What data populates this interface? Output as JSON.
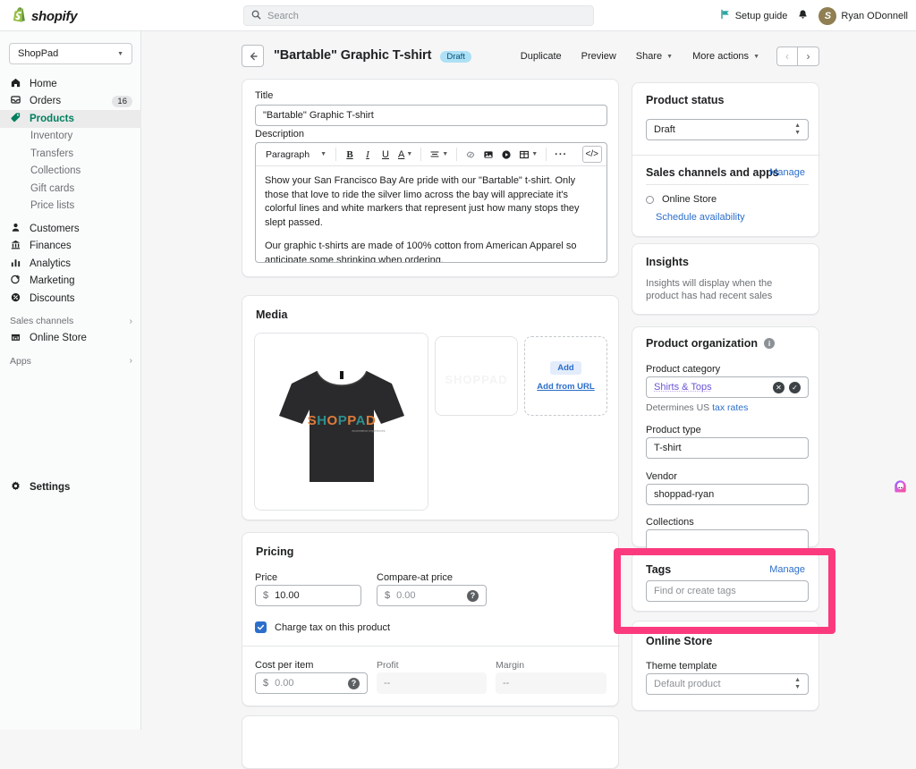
{
  "topbar": {
    "logo_text": "shopify",
    "search_placeholder": "Search",
    "setup_guide": "Setup guide",
    "user_name": "Ryan ODonnell",
    "avatar_letter": "S"
  },
  "sidebar": {
    "store": "ShopPad",
    "nav": [
      {
        "label": "Home"
      },
      {
        "label": "Orders",
        "badge": "16"
      },
      {
        "label": "Products"
      },
      {
        "label": "Customers"
      },
      {
        "label": "Finances"
      },
      {
        "label": "Analytics"
      },
      {
        "label": "Marketing"
      },
      {
        "label": "Discounts"
      }
    ],
    "product_subnav": [
      {
        "label": "Inventory"
      },
      {
        "label": "Transfers"
      },
      {
        "label": "Collections"
      },
      {
        "label": "Gift cards"
      },
      {
        "label": "Price lists"
      }
    ],
    "sales_channels_label": "Sales channels",
    "online_store": "Online Store",
    "apps_label": "Apps",
    "settings": "Settings"
  },
  "page_header": {
    "title": "\"Bartable\" Graphic T-shirt",
    "status_badge": "Draft",
    "duplicate": "Duplicate",
    "preview": "Preview",
    "share": "Share",
    "more_actions": "More actions"
  },
  "product": {
    "title_label": "Title",
    "title_value": "\"Bartable\" Graphic T-shirt",
    "description_label": "Description",
    "editor": {
      "block_style": "Paragraph",
      "paragraph_1": "Show your San Francisco Bay Are pride with our \"Bartable\" t-shirt. Only those that love to ride the silver limo across the bay will appreciate it's colorful lines and white markers that represent just how many stops they slept passed.",
      "paragraph_2": "Our graphic t-shirts are made of 100% cotton from American Apparel so anticipate some shrinking when ordering."
    },
    "media": {
      "title": "Media",
      "add_button": "Add",
      "add_from_url": "Add from URL",
      "shirt_logo": "SHOPPAD",
      "shirt_logo_sub": "ecommerce experiences"
    },
    "pricing": {
      "title": "Pricing",
      "price_label": "Price",
      "currency": "$",
      "price_value": "10.00",
      "compare_label": "Compare-at price",
      "compare_placeholder": "0.00",
      "tax_checkbox_label": "Charge tax on this product",
      "cost_label": "Cost per item",
      "cost_placeholder": "0.00",
      "profit_label": "Profit",
      "profit_value": "--",
      "margin_label": "Margin",
      "margin_value": "--"
    }
  },
  "side": {
    "status": {
      "title": "Product status",
      "value": "Draft"
    },
    "channels": {
      "title": "Sales channels and apps",
      "manage": "Manage",
      "item": "Online Store",
      "schedule": "Schedule availability"
    },
    "insights": {
      "title": "Insights",
      "body": "Insights will display when the product has had recent sales"
    },
    "organization": {
      "title": "Product organization",
      "category_label": "Product category",
      "category_value": "Shirts & Tops",
      "help_prefix": "Determines US",
      "help_link": "tax rates",
      "type_label": "Product type",
      "type_value": "T-shirt",
      "vendor_label": "Vendor",
      "vendor_value": "shoppad-ryan",
      "collections_label": "Collections",
      "collections_value": ""
    },
    "tags": {
      "label": "Tags",
      "manage": "Manage",
      "placeholder": "Find or create tags"
    },
    "online_store": {
      "title": "Online Store",
      "theme_label": "Theme template",
      "theme_value": "Default product"
    }
  },
  "annotation": {
    "highlight_color": "#fb3a7e"
  }
}
